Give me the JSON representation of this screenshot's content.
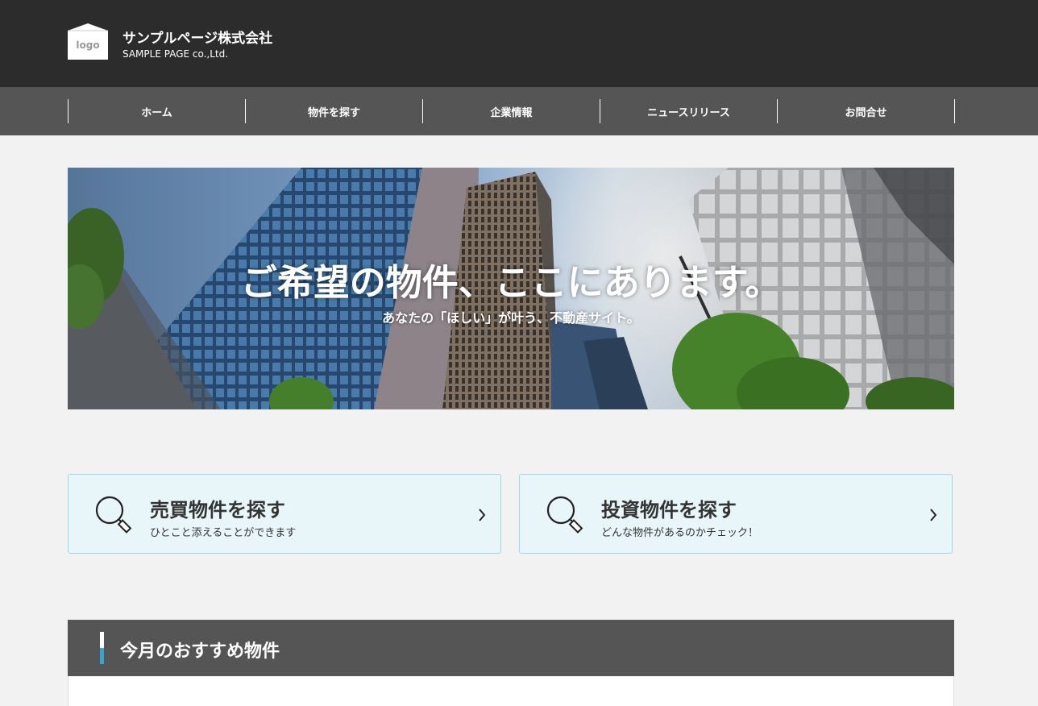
{
  "header": {
    "logo_text": "logo",
    "company_name": "サンプルページ株式会社",
    "company_sub": "SAMPLE PAGE co.,Ltd."
  },
  "nav": {
    "items": [
      {
        "label": "ホーム"
      },
      {
        "label": "物件を探す"
      },
      {
        "label": "企業情報"
      },
      {
        "label": "ニュースリリース"
      },
      {
        "label": "お問合せ"
      }
    ]
  },
  "hero": {
    "title": "ご希望の物件、ここにあります。",
    "subtitle": "あなたの「ほしい」が叶う、不動産サイト。"
  },
  "cards": [
    {
      "title": "売買物件を探す",
      "desc": "ひとこと添えることができます",
      "icon": "search-icon"
    },
    {
      "title": "投資物件を探す",
      "desc": "どんな物件があるのかチェック！",
      "icon": "search-icon"
    }
  ],
  "section": {
    "title": "今月のおすすめ物件"
  },
  "colors": {
    "header_bg": "#2c2c2c",
    "nav_bg": "#555555",
    "card_bg": "#e8f6fa",
    "card_border": "#9fd7ea",
    "accent": "#3aa5c8"
  }
}
